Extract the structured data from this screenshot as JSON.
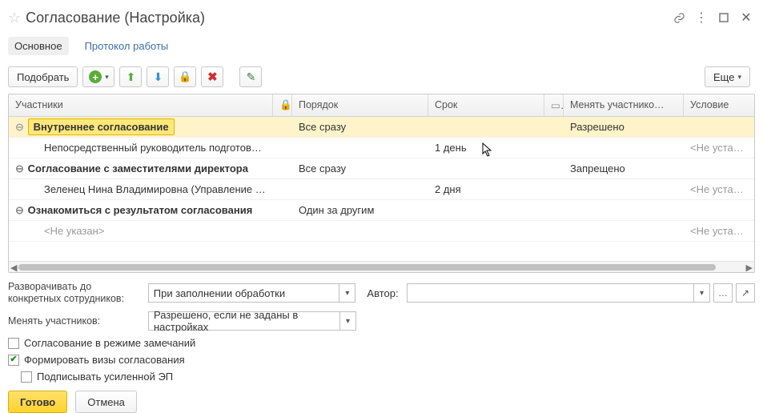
{
  "header": {
    "title": "Согласование (Настройка)"
  },
  "tabs": {
    "main": "Основное",
    "log": "Протокол работы"
  },
  "toolbar": {
    "pick": "Подобрать",
    "more": "Еще"
  },
  "columns": {
    "participants": "Участники",
    "order": "Порядок",
    "term": "Срок",
    "change": "Менять участнико…",
    "condition": "Условие"
  },
  "rows": {
    "r0": {
      "name": "Внутреннее согласование",
      "order": "Все сразу",
      "change": "Разрешено"
    },
    "r1": {
      "name": "Непосредственный руководитель подготовивш…",
      "term": "1 день",
      "cond": "<Не установлен…"
    },
    "r2": {
      "name": "Согласование с заместителями директора",
      "order": "Все сразу",
      "change": "Запрещено"
    },
    "r3": {
      "name": "Зеленец Нина Владимировна (Управление бухг…",
      "term": "2 дня",
      "cond": "<Не установлен…"
    },
    "r4": {
      "name": "Ознакомиться с результатом согласования",
      "order": "Один за другим"
    },
    "r5": {
      "name": "<Не указан>",
      "cond": "<Не установлен…"
    }
  },
  "form": {
    "expand_lbl": "Разворачивать до\nконкретных сотрудников:",
    "expand_val": "При заполнении обработки",
    "author_lbl": "Автор:",
    "author_val": "",
    "change_lbl": "Менять участников:",
    "change_val": "Разрешено, если не заданы в настройках",
    "chk_remarks": "Согласование в режиме замечаний",
    "chk_visas": "Формировать визы согласования",
    "chk_sign": "Подписывать усиленной ЭП"
  },
  "footer": {
    "done": "Готово",
    "cancel": "Отмена"
  }
}
